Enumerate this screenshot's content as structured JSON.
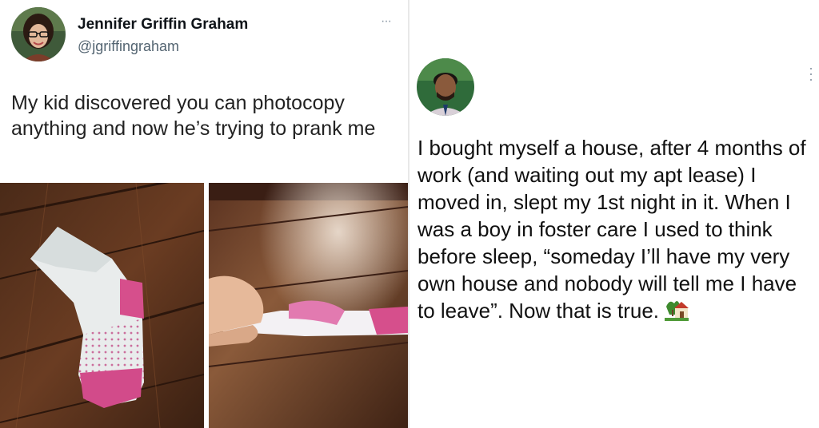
{
  "left_tweet": {
    "author_name": "Jennifer Griffin Graham",
    "author_handle": "@jgriffingraham",
    "more_label": "···",
    "text": "My kid discovered you can photocopy anything and now he’s trying to prank me",
    "photos": [
      {
        "name": "socks-on-floor-photo"
      },
      {
        "name": "photocopied-sock-paper-photo"
      }
    ]
  },
  "right_tweet": {
    "more_label": "⋮",
    "text": "I bought myself a house, after 4 months of work (and waiting out my apt lease) I moved in, slept my 1st night in it. When I was a boy in foster care I used to think before sleep, “someday I’ll have my very own house and nobody will tell me I have to leave”. Now that is true.",
    "emoji": "house-with-garden-icon"
  }
}
